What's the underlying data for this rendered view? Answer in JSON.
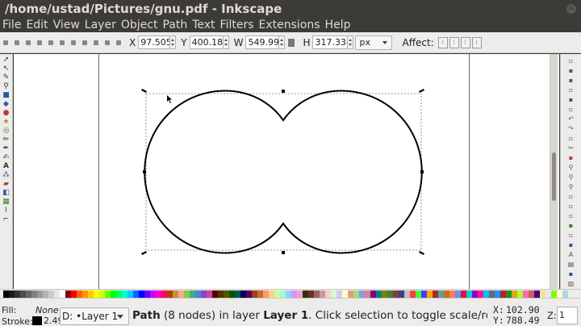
{
  "window": {
    "title": "/home/ustad/Pictures/gnu.pdf - Inkscape",
    "close_icon": "close-icon"
  },
  "menu": [
    "File",
    "Edit",
    "View",
    "Layer",
    "Object",
    "Path",
    "Text",
    "Filters",
    "Extensions",
    "Help"
  ],
  "controls": {
    "x_label": "X",
    "x_value": "97.505",
    "y_label": "Y",
    "y_value": "400.180",
    "w_label": "W",
    "w_value": "549.990",
    "h_label": "H",
    "h_value": "317.334",
    "unit": "px",
    "affect_label": "Affect:"
  },
  "status": {
    "fill_label": "Fill:",
    "fill_value": "None",
    "stroke_label": "Stroke:",
    "stroke_width": "2.49",
    "stroke_color": "#000000",
    "layer_current": "•Layer 1",
    "layer_prefix": "D:",
    "msg_object": "Path",
    "msg_part1": " (8 nodes) in layer ",
    "msg_layer": "Layer 1",
    "msg_part2": ". Click selection to toggle scale/rotati",
    "x_label": "X:",
    "x_value": "102.90",
    "y_label": "Y:",
    "y_value": "788.49",
    "zoom_label": "Z:",
    "zoom_value": "1"
  },
  "palette": [
    "#000000",
    "#1a1a1a",
    "#333333",
    "#4d4d4d",
    "#666666",
    "#808080",
    "#999999",
    "#b3b3b3",
    "#cccccc",
    "#e6e6e6",
    "#ffffff",
    "#800000",
    "#ff0000",
    "#ff6600",
    "#ff9900",
    "#ffcc00",
    "#ffff00",
    "#ccff00",
    "#66ff00",
    "#00ff00",
    "#00ff66",
    "#00ffcc",
    "#00ccff",
    "#0066ff",
    "#0000ff",
    "#6600ff",
    "#cc00ff",
    "#ff00cc",
    "#ff0066",
    "#aa4400",
    "#cc8844",
    "#ffaa88",
    "#88cc44",
    "#44aa88",
    "#4488cc",
    "#8844cc",
    "#cc44aa",
    "#550000",
    "#553300",
    "#555500",
    "#005500",
    "#005555",
    "#000055",
    "#550055",
    "#994422",
    "#cc6633",
    "#ff9966",
    "#ffcc99",
    "#ccff99",
    "#99ffcc",
    "#99ccff",
    "#cc99ff",
    "#ff99cc",
    "#333300",
    "#663333",
    "#996666",
    "#cc9999",
    "#ffcccc",
    "#ccffcc",
    "#ccccff",
    "#ffffcc",
    "#e0a080",
    "#a0e080",
    "#80a0e0",
    "#e080a0",
    "#800080",
    "#008080",
    "#808000",
    "#408040",
    "#804040",
    "#404080",
    "#c0c0c0",
    "#ff4040",
    "#40ff40",
    "#4040ff",
    "#ffa500",
    "#a52a2a",
    "#5f9ea0",
    "#d2691e",
    "#ff7f50",
    "#6495ed",
    "#dc143c",
    "#00ced1",
    "#9400d3",
    "#ff1493",
    "#00bfff",
    "#696969",
    "#1e90ff",
    "#b22222",
    "#228b22",
    "#daa520",
    "#adff2f",
    "#ff69b4",
    "#cd5c5c",
    "#4b0082",
    "#f0e68c",
    "#e6e6fa",
    "#7cfc00",
    "#fffacd",
    "#add8e6"
  ]
}
